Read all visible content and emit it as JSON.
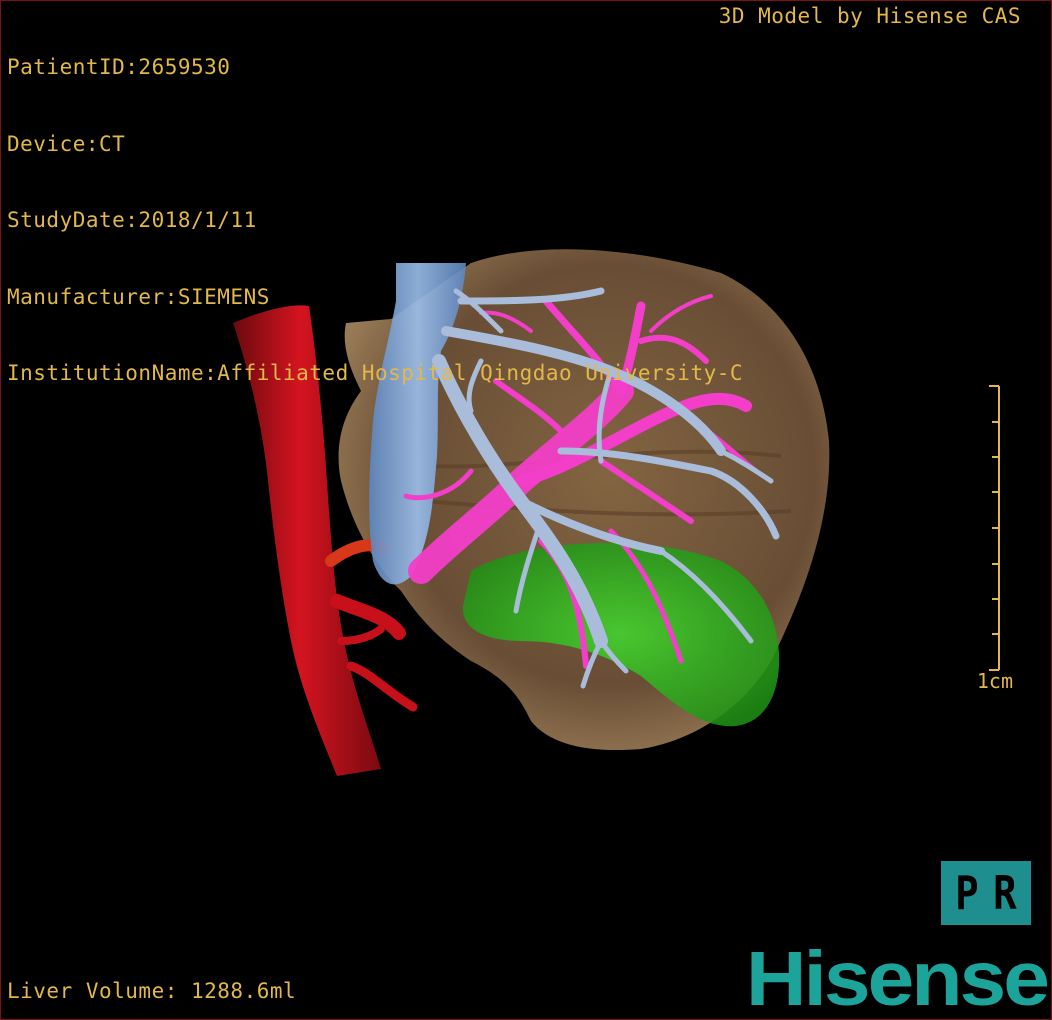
{
  "header": {
    "patient_id": "PatientID:2659530",
    "device": "Device:CT",
    "study_date": "StudyDate:2018/1/11",
    "manufacturer": "Manufacturer:SIEMENS",
    "institution": "InstitutionName:Affiliated Hospital Qingdao University-C",
    "credit": "3D Model by Hisense CAS"
  },
  "footer": {
    "liver_volume": "Liver Volume: 1288.6ml"
  },
  "scale": {
    "label": "1cm"
  },
  "pr_button": {
    "letter_p": "P",
    "letter_r": "R",
    "color": "#1f8e8e"
  },
  "logo": {
    "text": "Hisense",
    "color": "#1ca39a"
  },
  "model": {
    "structures": [
      {
        "name": "liver",
        "color": "#7a5a3a"
      },
      {
        "name": "aorta",
        "color": "#c8101a"
      },
      {
        "name": "inferior-vena-cava",
        "color": "#7aa6d8"
      },
      {
        "name": "hepatic-veins",
        "color": "#9fb4d4"
      },
      {
        "name": "portal-vein",
        "color": "#f23ec8"
      },
      {
        "name": "gallbladder",
        "color": "#39c826"
      }
    ]
  },
  "colors": {
    "overlay_text": "#e3b84a",
    "border": "#7a1414",
    "background": "#000000"
  }
}
